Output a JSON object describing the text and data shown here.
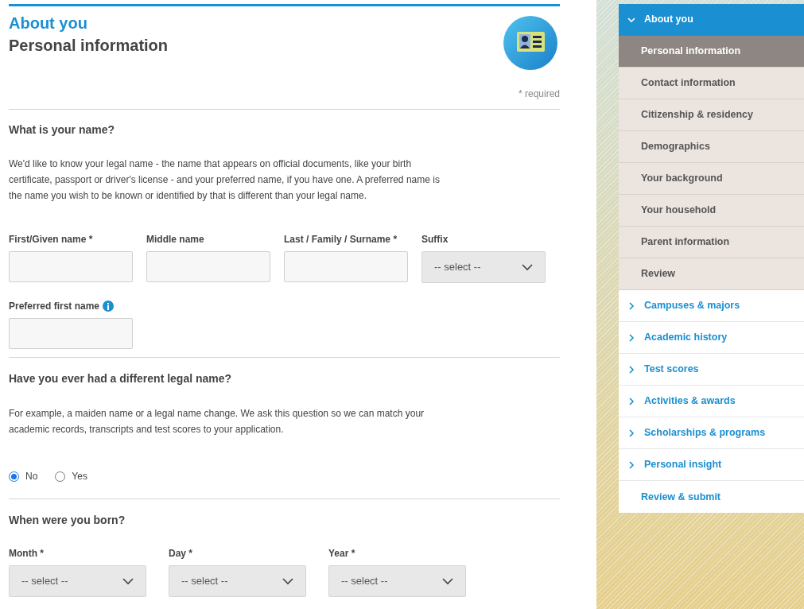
{
  "header": {
    "section": "About you",
    "title": "Personal information"
  },
  "required_note": "* required",
  "name_section": {
    "heading": "What is your name?",
    "description": "We'd like to know your legal name - the name that appears on official documents, like your birth certificate, passport or driver's license - and your preferred name, if you have one. A preferred name is the name you wish to be known or identified by that is different than your legal name.",
    "fields": [
      {
        "kind": "text",
        "label": "First/Given name *"
      },
      {
        "kind": "text",
        "label": "Middle name"
      },
      {
        "kind": "text",
        "label": "Last / Family / Surname *"
      },
      {
        "kind": "select",
        "label": "Suffix",
        "value": "-- select --"
      }
    ],
    "preferred": {
      "label": "Preferred first name"
    }
  },
  "legal_name_section": {
    "heading": "Have you ever had a different legal name?",
    "description": "For example, a maiden name or a legal name change. We ask this question so we can match your academic records, transcripts and test scores to your application.",
    "options": [
      {
        "label": "No",
        "selected": true
      },
      {
        "label": "Yes",
        "selected": false
      }
    ]
  },
  "birth_section": {
    "heading": "When were you born?",
    "fields": [
      {
        "kind": "select",
        "label": "Month *",
        "value": "-- select --"
      },
      {
        "kind": "select",
        "label": "Day *",
        "value": "-- select --"
      },
      {
        "kind": "select",
        "label": "Year *",
        "value": "-- select --"
      }
    ]
  },
  "nav": [
    {
      "kind": "group",
      "label": "About you",
      "expanded": true,
      "children": [
        {
          "label": "Personal information",
          "selected": true
        },
        {
          "label": "Contact information",
          "selected": false
        },
        {
          "label": "Citizenship & residency",
          "selected": false
        },
        {
          "label": "Demographics",
          "selected": false
        },
        {
          "label": "Your background",
          "selected": false
        },
        {
          "label": "Your household",
          "selected": false
        },
        {
          "label": "Parent information",
          "selected": false
        },
        {
          "label": "Review",
          "selected": false
        }
      ]
    },
    {
      "kind": "group",
      "label": "Campuses & majors",
      "expanded": false
    },
    {
      "kind": "group",
      "label": "Academic history",
      "expanded": false
    },
    {
      "kind": "group",
      "label": "Test scores",
      "expanded": false
    },
    {
      "kind": "group",
      "label": "Activities & awards",
      "expanded": false
    },
    {
      "kind": "group",
      "label": "Scholarships & programs",
      "expanded": false
    },
    {
      "kind": "group",
      "label": "Personal insight",
      "expanded": false
    },
    {
      "kind": "link",
      "label": "Review & submit"
    }
  ]
}
